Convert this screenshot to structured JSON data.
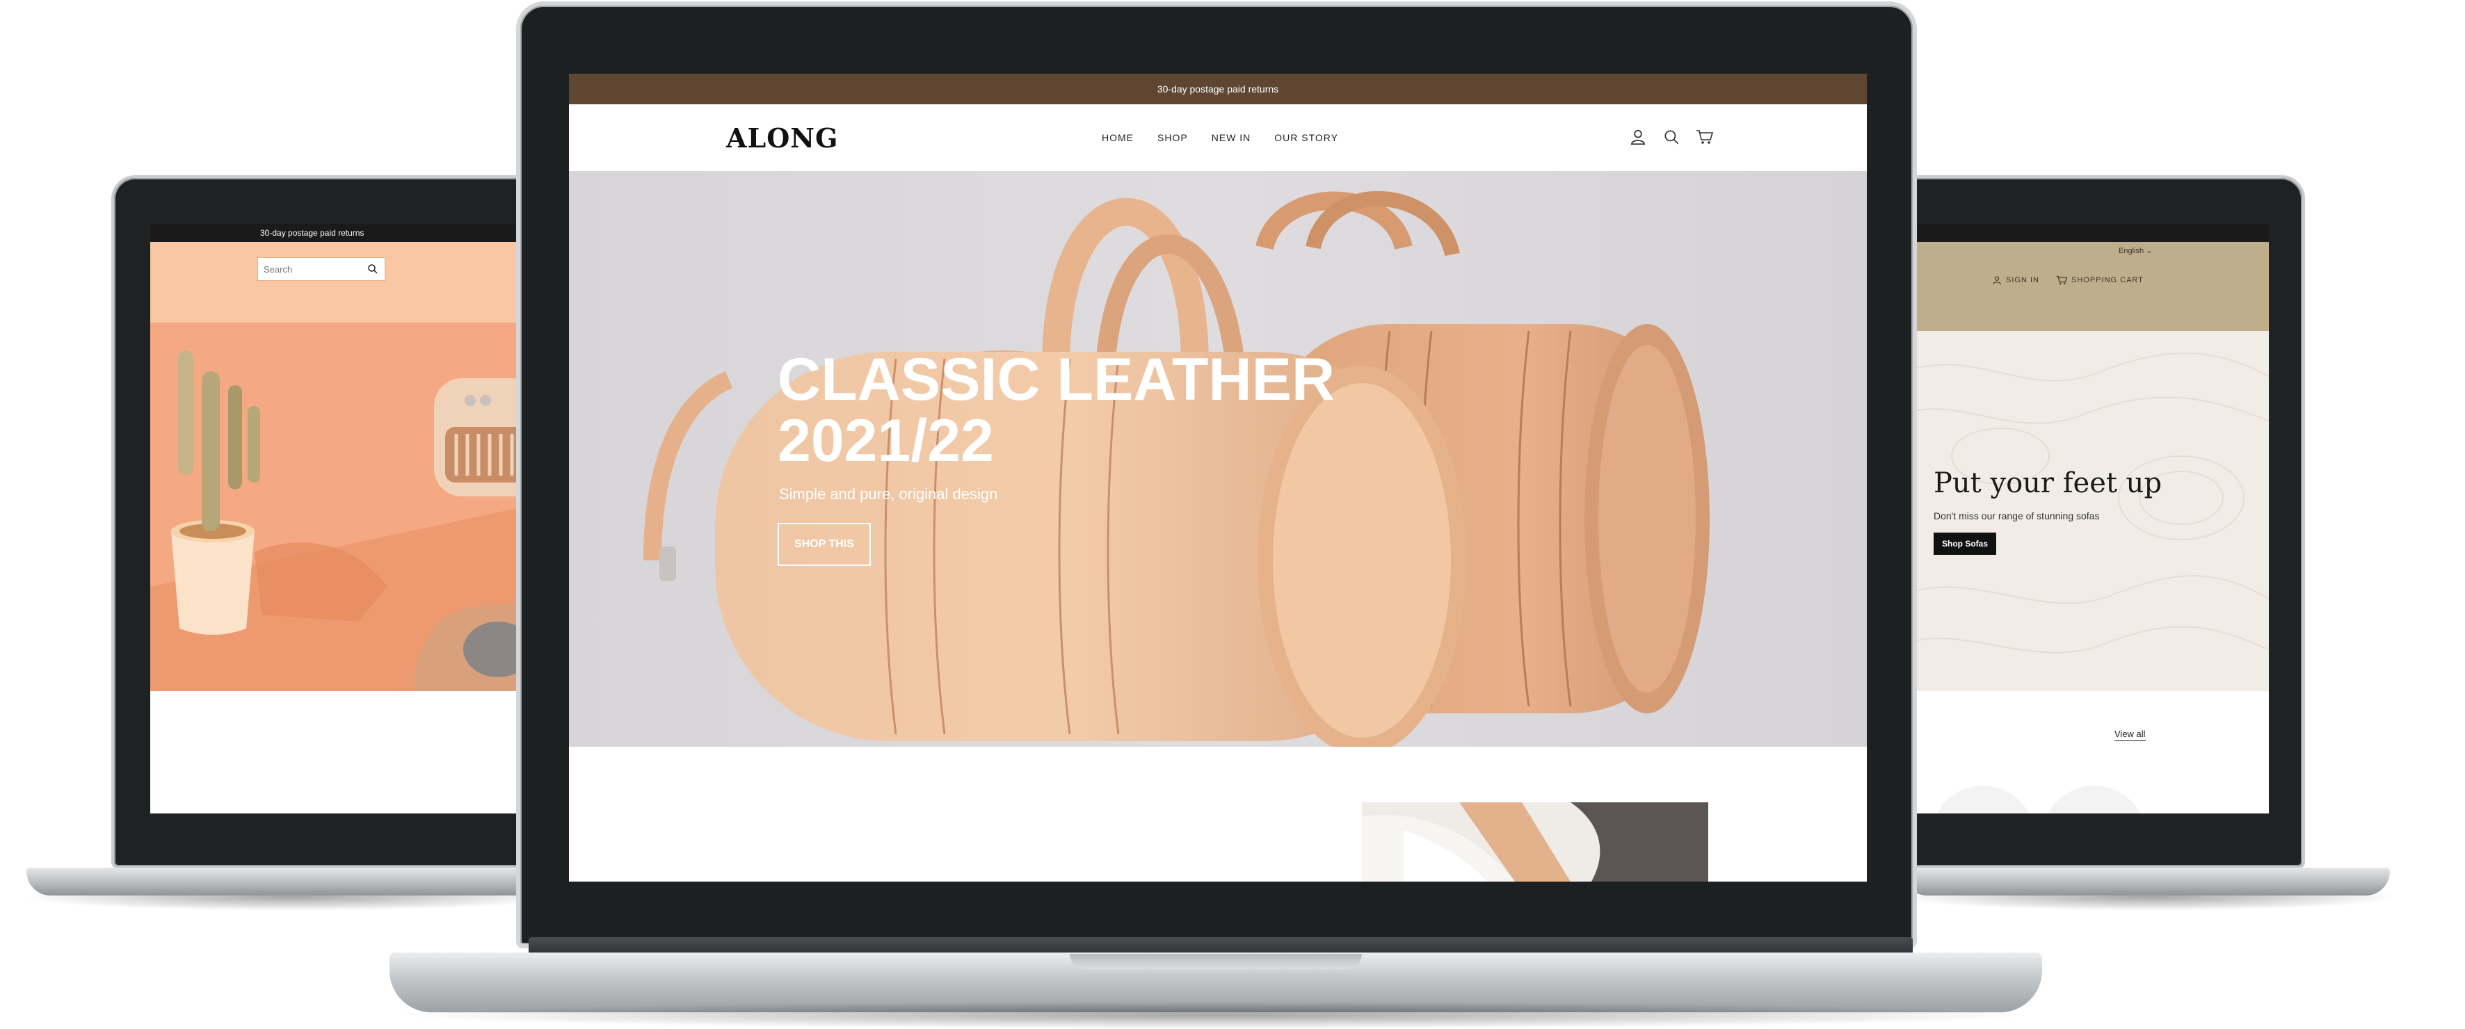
{
  "center": {
    "announcement": "30-day postage paid returns",
    "logo": "ALONG",
    "nav": [
      "HOME",
      "SHOP",
      "NEW IN",
      "OUR STORY"
    ],
    "hero": {
      "title_line1": "CLASSIC LEATHER",
      "title_line2": "2021/22",
      "subtitle": "Simple and pure, original design",
      "button": "SHOP THIS"
    }
  },
  "left": {
    "announcement": "30-day postage paid returns",
    "search_placeholder": "Search"
  },
  "right": {
    "language": "English ⌄",
    "sign_in": "SIGN IN",
    "cart": "SHOPPING CART",
    "hero": {
      "title": "Put your feet up",
      "subtitle": "Don't miss our range of stunning sofas",
      "button": "Shop Sofas"
    },
    "view_all": "View all"
  },
  "colors": {
    "announcement_bar": "#5e4632",
    "left_header": "#f9c7a3",
    "right_header": "#beae8c",
    "right_hero_bg": "#f1ede6",
    "leather": "#e7b38c"
  }
}
